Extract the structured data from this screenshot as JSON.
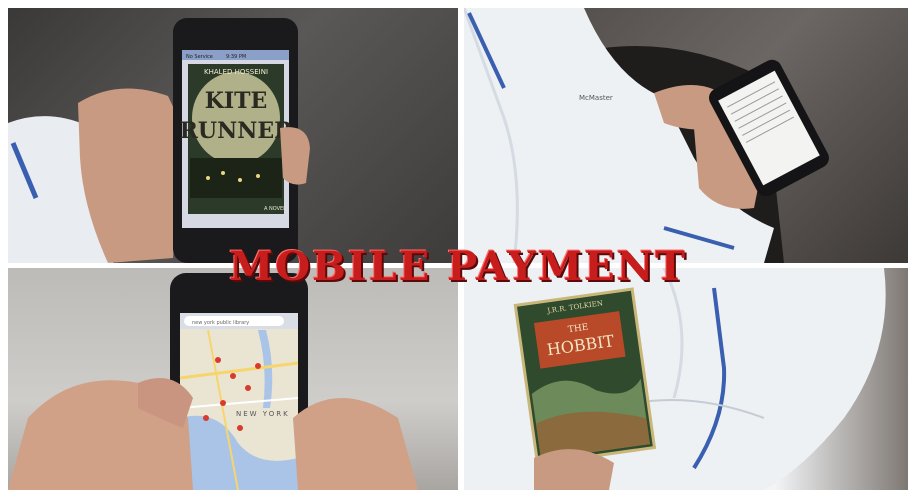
{
  "overlay_title": "MOBILE PAYMENT",
  "panels": {
    "ebook": {
      "status_left": "No Service",
      "status_time": "9:39 PM",
      "book_author": "KHALED HOSSEINI",
      "book_title_line1": "KITE",
      "book_title_line2": "RUNNER",
      "book_footer": "A NOVEL"
    },
    "reader": {
      "jacket_brand": "McMaster"
    },
    "map": {
      "search_placeholder": "new york public library",
      "city_label": "NEW YORK"
    },
    "book": {
      "author": "J.R.R. TOLKIEN",
      "title_line1": "THE",
      "title_line2": "HOBBIT"
    }
  },
  "colors": {
    "title_red": "#c81d1d",
    "divider": "#ffffff",
    "jacket_white": "#eef1f4",
    "jacket_stripe": "#3a5fb0"
  }
}
